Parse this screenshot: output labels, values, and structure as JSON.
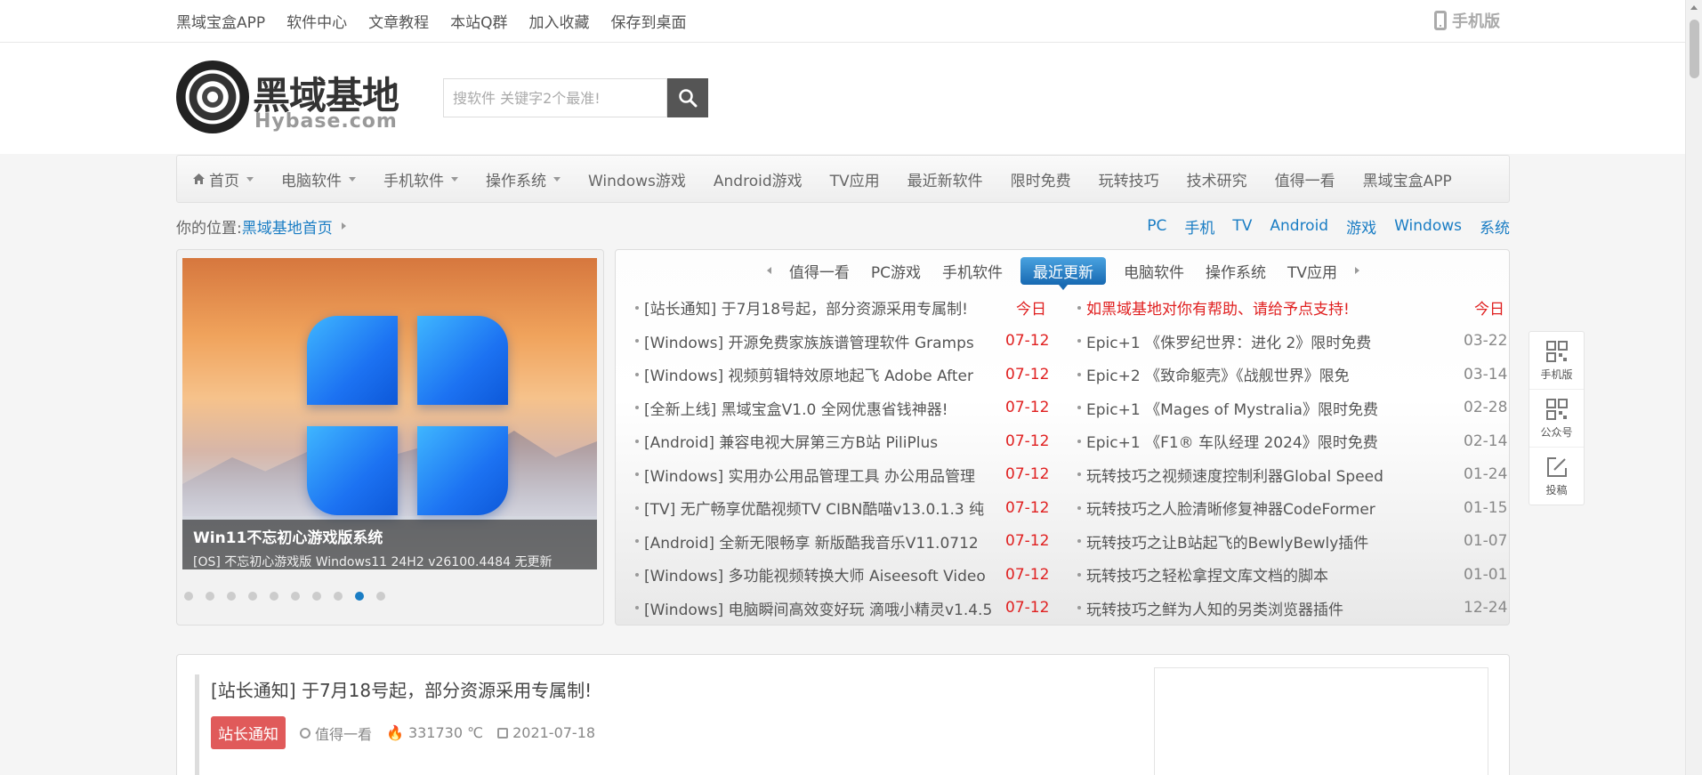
{
  "topbar": {
    "links": [
      "黑域宝盒APP",
      "软件中心",
      "文章教程",
      "本站Q群",
      "加入收藏",
      "保存到桌面"
    ],
    "mobile_label": "手机版"
  },
  "logo": {
    "cn": "黑域基地",
    "en": "Hybase.com"
  },
  "search": {
    "placeholder": "搜软件 关键字2个最准!"
  },
  "nav": {
    "items": [
      {
        "label": "首页",
        "dropdown": true,
        "icon": "home-icon"
      },
      {
        "label": "电脑软件",
        "dropdown": true
      },
      {
        "label": "手机软件",
        "dropdown": true
      },
      {
        "label": "操作系统",
        "dropdown": true
      },
      {
        "label": "Windows游戏",
        "dropdown": false
      },
      {
        "label": "Android游戏",
        "dropdown": false
      },
      {
        "label": "TV应用",
        "dropdown": false
      },
      {
        "label": "最近新软件",
        "dropdown": false
      },
      {
        "label": "限时免费",
        "dropdown": false
      },
      {
        "label": "玩转技巧",
        "dropdown": false
      },
      {
        "label": "技术研究",
        "dropdown": false
      },
      {
        "label": "值得一看",
        "dropdown": false
      },
      {
        "label": "黑域宝盒APP",
        "dropdown": false
      }
    ]
  },
  "breadcrumb": {
    "prefix": "你的位置:",
    "home": "黑域基地首页"
  },
  "quick_tags": [
    "PC",
    "手机",
    "TV",
    "Android",
    "游戏",
    "Windows",
    "系统"
  ],
  "slider": {
    "title": "Win11不忘初心游戏版系统",
    "subtitle": "[OS] 不忘初心游戏版 Windows11 24H2 v26100.4484 无更新",
    "dot_count": 10,
    "active_dot": 8
  },
  "news_tabs": {
    "items": [
      "值得一看",
      "PC游戏",
      "手机软件",
      "最近更新",
      "电脑软件",
      "操作系统",
      "TV应用"
    ],
    "active": "最近更新"
  },
  "news_left": [
    {
      "text": "[站长通知] 于7月18号起，部分资源采用专属制!",
      "date": "今日"
    },
    {
      "text": "[Windows] 开源免费家族族谱管理软件 Gramps",
      "date": "07-12"
    },
    {
      "text": "[Windows] 视频剪辑特效原地起飞 Adobe After",
      "date": "07-12"
    },
    {
      "text": "[全新上线] 黑域宝盒V1.0 全网优惠省钱神器!",
      "date": "07-12"
    },
    {
      "text": "[Android] 兼容电视大屏第三方B站 PiliPlus",
      "date": "07-12"
    },
    {
      "text": "[Windows] 实用办公用品管理工具 办公用品管理",
      "date": "07-12"
    },
    {
      "text": "[TV] 无广畅享优酷视频TV CIBN酷喵v13.0.1.3 纯",
      "date": "07-12"
    },
    {
      "text": "[Android] 全新无限畅享 新版酷我音乐V11.0712",
      "date": "07-12"
    },
    {
      "text": "[Windows] 多功能视频转换大师 Aiseesoft Video",
      "date": "07-12"
    },
    {
      "text": "[Windows] 电脑瞬间高效变好玩 滴哦小精灵v1.4.5",
      "date": "07-12"
    }
  ],
  "news_right": [
    {
      "text": "如黑域基地对你有帮助、请给予点支持!",
      "date": "今日",
      "highlight": true
    },
    {
      "text": "Epic+1 《侏罗纪世界：进化 2》限时免费",
      "date": "03-22"
    },
    {
      "text": "Epic+2 《致命躯壳》《战舰世界》限免",
      "date": "03-14"
    },
    {
      "text": "Epic+1 《Mages of Mystralia》限时免费",
      "date": "02-28"
    },
    {
      "text": "Epic+1 《F1® 车队经理 2024》限时免费",
      "date": "02-14"
    },
    {
      "text": "玩转技巧之视频速度控制利器Global Speed",
      "date": "01-24"
    },
    {
      "text": "玩转技巧之人脸清晰修复神器CodeFormer",
      "date": "01-15"
    },
    {
      "text": "玩转技巧之让B站起飞的BewlyBewly插件",
      "date": "01-07"
    },
    {
      "text": "玩转技巧之轻松拿捏文库文档的脚本",
      "date": "01-01"
    },
    {
      "text": "玩转技巧之鲜为人知的另类浏览器插件",
      "date": "12-24"
    }
  ],
  "side_float": [
    {
      "label": "手机版",
      "icon": "qr-code-icon"
    },
    {
      "label": "公众号",
      "icon": "qr-code-icon"
    },
    {
      "label": "投稿",
      "icon": "edit-icon"
    }
  ],
  "article": {
    "title": "[站长通知] 于7月18号起，部分资源采用专属制!",
    "badge": "站长通知",
    "category": "值得一看",
    "heat": "331730 ℃",
    "date": "2021-07-18"
  },
  "colors": {
    "accent": "#1a7dc4",
    "red": "#e02020",
    "badge": "#e05a5a"
  }
}
